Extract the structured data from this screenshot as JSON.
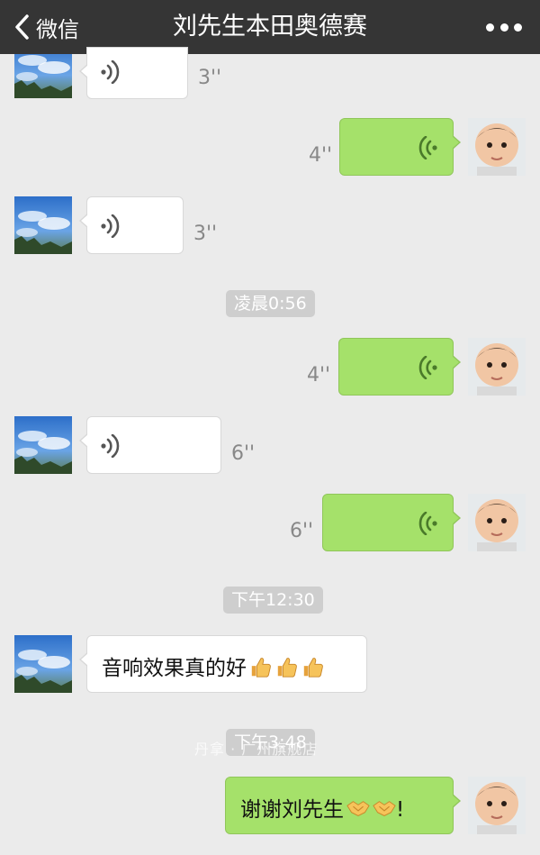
{
  "header": {
    "back_label": "微信",
    "title": "刘先生本田奥德赛"
  },
  "messages": [
    {
      "kind": "voice",
      "dir": "in",
      "duration": "3''"
    },
    {
      "kind": "voice",
      "dir": "out",
      "duration": "4''"
    },
    {
      "kind": "voice",
      "dir": "in",
      "duration": "3''"
    },
    {
      "kind": "time",
      "text": "凌晨0:56"
    },
    {
      "kind": "voice",
      "dir": "out",
      "duration": "4''"
    },
    {
      "kind": "voice",
      "dir": "in",
      "duration": "6''"
    },
    {
      "kind": "voice",
      "dir": "out",
      "duration": "6''"
    },
    {
      "kind": "time",
      "text": "下午12:30"
    },
    {
      "kind": "text",
      "dir": "in",
      "text": "音响效果真的好",
      "emoji": "thumbs-up-emoji ×3"
    },
    {
      "kind": "time",
      "text": "下午3:48"
    },
    {
      "kind": "text",
      "dir": "out",
      "text": "谢谢刘先生",
      "suffix": "!",
      "emoji": "handshake-emoji ×2"
    }
  ],
  "watermark": "丹拿 · 广州旗舰店",
  "colors": {
    "nav": "#353535",
    "bg": "#ebebeb",
    "out_bubble": "#a5e16a",
    "in_bubble": "#ffffff"
  }
}
